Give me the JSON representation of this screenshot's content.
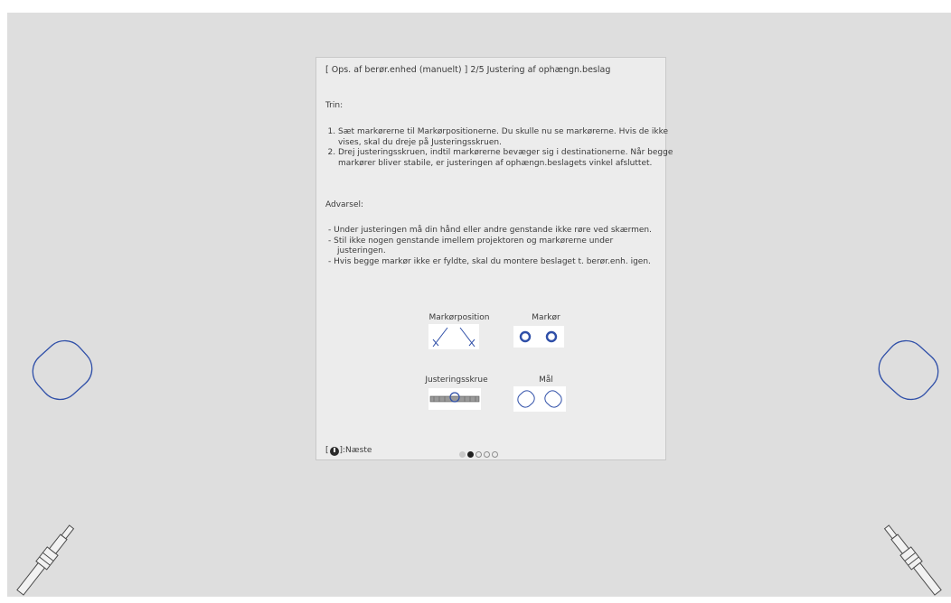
{
  "panel": {
    "header": "[ Ops. af berør.enhed (manuelt) ]  2/5 Justering af ophængn.beslag",
    "steps_title": "Trin:",
    "steps": [
      "Sæt markørerne til Markørpositionerne. Du skulle nu se markørerne. Hvis de ikke vises, skal du dreje på Justeringsskruen.",
      "Drej justeringsskruen, indtil markørerne bevæger sig i destinationerne. Når begge markører bliver stabile, er justeringen af ophængn.beslagets vinkel afsluttet."
    ],
    "warning_title": "Advarsel:",
    "warnings": [
      "Under justeringen må din hånd eller andre genstande ikke røre ved skærmen.",
      "Stil ikke nogen genstande imellem projektoren og markørerne under justeringen.",
      "Hvis begge markør ikke er fyldte, skal du montere beslaget t. berør.enh. igen."
    ],
    "legend": {
      "marker_position": "Markørposition",
      "marker": "Markør",
      "adjustment_screw": "Justeringsskrue",
      "target": "Mål"
    },
    "footer": {
      "next_prefix": "[",
      "next_suffix": "]:Næste",
      "page_count": 5,
      "current_page": 2
    }
  },
  "colors": {
    "accent": "#2f4fa8",
    "screen_bg": "#dedede",
    "panel_bg": "#ececec"
  },
  "icons": [
    "power-button-icon",
    "target-outline-icon",
    "mounting-bracket-icon",
    "marker-ring-icon",
    "adjustment-screw-icon"
  ]
}
